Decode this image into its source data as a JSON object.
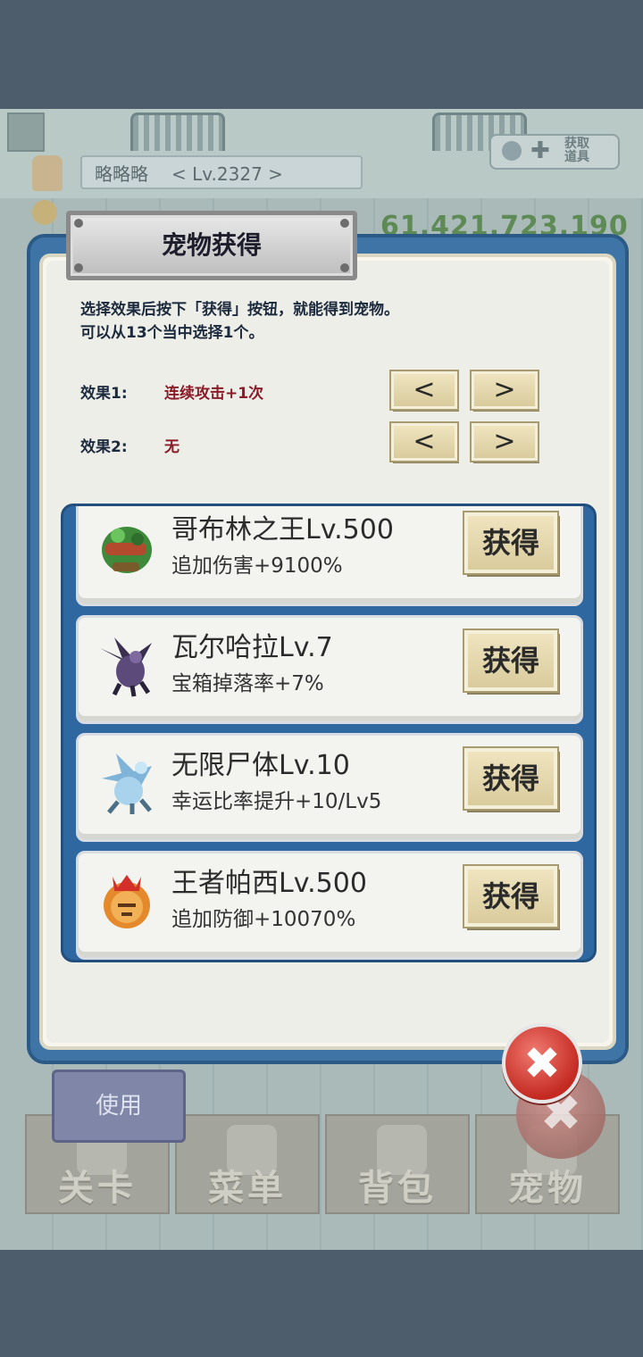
{
  "background": {
    "player_name": "略略略",
    "player_level": "< Lv.2327 >",
    "gold": "61,421,723,190",
    "gift_label": "获取\n道具",
    "use_button": "使用",
    "tabs": [
      "关卡",
      "菜单",
      "背包",
      "宠物"
    ]
  },
  "dialog": {
    "title": "宠物获得",
    "instruction_line1": "选择效果后按下「获得」按钮，就能得到宠物。",
    "instruction_line2": "可以从13个当中选择1个。",
    "effects": [
      {
        "label": "效果1:",
        "value": "连续攻击+1次"
      },
      {
        "label": "效果2:",
        "value": "无"
      }
    ],
    "prev_glyph": "<",
    "next_glyph": ">",
    "pets": [
      {
        "name": "哥布林之王Lv.500",
        "desc": "追加伤害+9100%",
        "button": "获得",
        "icon": "goblin-king-icon"
      },
      {
        "name": "瓦尔哈拉Lv.7",
        "desc": "宝箱掉落率+7%",
        "button": "获得",
        "icon": "dark-dragon-icon"
      },
      {
        "name": "无限尸体Lv.10",
        "desc": "幸运比率提升+10/Lv5",
        "button": "获得",
        "icon": "ice-dragon-icon"
      },
      {
        "name": "王者帕西Lv.500",
        "desc": "追加防御+10070%",
        "button": "获得",
        "icon": "crowned-lion-icon"
      }
    ],
    "close_glyph": "✖"
  },
  "colors": {
    "dialog_border": "#3f74a6",
    "effect_value": "#8a1c28",
    "button_face": "#e6d9ad",
    "close_red": "#c42a22"
  }
}
